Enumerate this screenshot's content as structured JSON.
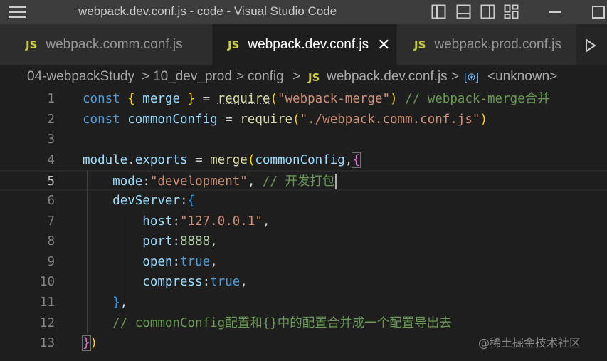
{
  "window": {
    "title": "webpack.dev.conf.js - code - Visual Studio Code",
    "icons": [
      "menu-icon",
      "toggle-sidebar-icon",
      "toggle-panel-icon",
      "toggle-secondary-sidebar-icon",
      "customize-layout-icon",
      "minimize-icon",
      "maximize-icon"
    ]
  },
  "tabs": [
    {
      "badge": "JS",
      "label": "webpack.comm.conf.js",
      "active": false
    },
    {
      "badge": "JS",
      "label": "webpack.dev.conf.js",
      "active": true,
      "close": "✕"
    },
    {
      "badge": "JS",
      "label": "webpack.prod.conf.js",
      "active": false
    }
  ],
  "breadcrumb": {
    "items": [
      "04-webpackStudy",
      "10_dev_prod",
      "config"
    ],
    "separator": ">",
    "file_badge": "JS",
    "file": "webpack.dev.conf.js",
    "symbol_icon": "[⊛]",
    "symbol": "<unknown>"
  },
  "editor": {
    "current_line": 5,
    "line_numbers": [
      "1",
      "2",
      "3",
      "4",
      "5",
      "6",
      "7",
      "8",
      "9",
      "10",
      "11",
      "12",
      "13"
    ],
    "lines": [
      [
        {
          "c": "kw",
          "t": "const "
        },
        {
          "c": "p1",
          "t": "{ "
        },
        {
          "c": "var",
          "t": "merge"
        },
        {
          "c": "p1",
          "t": " }"
        },
        {
          "c": "punc",
          "t": " = "
        },
        {
          "c": "fn",
          "t": "require",
          "squiggle": true
        },
        {
          "c": "p1",
          "t": "("
        },
        {
          "c": "str",
          "t": "\"webpack-merge\""
        },
        {
          "c": "p1",
          "t": ")"
        },
        {
          "c": "cm",
          "t": " // webpack-merge合并"
        }
      ],
      [
        {
          "c": "kw",
          "t": "const "
        },
        {
          "c": "var",
          "t": "commonConfig"
        },
        {
          "c": "punc",
          "t": " = "
        },
        {
          "c": "fn",
          "t": "require"
        },
        {
          "c": "p1",
          "t": "("
        },
        {
          "c": "str",
          "t": "\"./webpack.comm.conf.js\""
        },
        {
          "c": "p1",
          "t": ")"
        }
      ],
      [],
      [
        {
          "c": "var",
          "t": "module"
        },
        {
          "c": "punc",
          "t": "."
        },
        {
          "c": "var",
          "t": "exports"
        },
        {
          "c": "punc",
          "t": " = "
        },
        {
          "c": "fn",
          "t": "merge"
        },
        {
          "c": "p1",
          "t": "("
        },
        {
          "c": "var",
          "t": "commonConfig"
        },
        {
          "c": "punc",
          "t": ","
        },
        {
          "c": "p2",
          "t": "{",
          "hl": true
        }
      ],
      [
        {
          "c": "punc",
          "t": "    "
        },
        {
          "c": "var",
          "t": "mode"
        },
        {
          "c": "punc",
          "t": ":"
        },
        {
          "c": "str",
          "t": "\"development\""
        },
        {
          "c": "punc",
          "t": ", "
        },
        {
          "c": "cm",
          "t": "// 开发打包"
        },
        {
          "c": "cursor",
          "t": ""
        }
      ],
      [
        {
          "c": "punc",
          "t": "    "
        },
        {
          "c": "var",
          "t": "devServer"
        },
        {
          "c": "punc",
          "t": ":"
        },
        {
          "c": "p3",
          "t": "{"
        }
      ],
      [
        {
          "c": "punc",
          "t": "        "
        },
        {
          "c": "var",
          "t": "host"
        },
        {
          "c": "punc",
          "t": ":"
        },
        {
          "c": "str",
          "t": "\"127.0.0.1\""
        },
        {
          "c": "punc",
          "t": ","
        }
      ],
      [
        {
          "c": "punc",
          "t": "        "
        },
        {
          "c": "var",
          "t": "port"
        },
        {
          "c": "punc",
          "t": ":"
        },
        {
          "c": "num",
          "t": "8888"
        },
        {
          "c": "punc",
          "t": ","
        }
      ],
      [
        {
          "c": "punc",
          "t": "        "
        },
        {
          "c": "var",
          "t": "open"
        },
        {
          "c": "punc",
          "t": ":"
        },
        {
          "c": "bool",
          "t": "true"
        },
        {
          "c": "punc",
          "t": ","
        }
      ],
      [
        {
          "c": "punc",
          "t": "        "
        },
        {
          "c": "var",
          "t": "compress"
        },
        {
          "c": "punc",
          "t": ":"
        },
        {
          "c": "bool",
          "t": "true"
        },
        {
          "c": "punc",
          "t": ","
        }
      ],
      [
        {
          "c": "punc",
          "t": "    "
        },
        {
          "c": "p3",
          "t": "}"
        },
        {
          "c": "punc",
          "t": ","
        }
      ],
      [
        {
          "c": "punc",
          "t": "    "
        },
        {
          "c": "cm",
          "t": "// commonConfig配置和{}中的配置合并成一个配置导出去"
        }
      ],
      [
        {
          "c": "p2",
          "t": "}",
          "hl": true
        },
        {
          "c": "p1",
          "t": ")"
        }
      ]
    ]
  },
  "watermark": "@稀土掘金技术社区",
  "colors": {
    "titlebar": "#3c3c3c",
    "tabbar": "#252526",
    "editor_bg": "#1e1e1e",
    "js_badge": "#cbcb41",
    "keyword": "#569cd6",
    "variable": "#9cdcfe",
    "function": "#dcdcaa",
    "string": "#ce9178",
    "number": "#b5cea8",
    "comment": "#6a9955"
  }
}
